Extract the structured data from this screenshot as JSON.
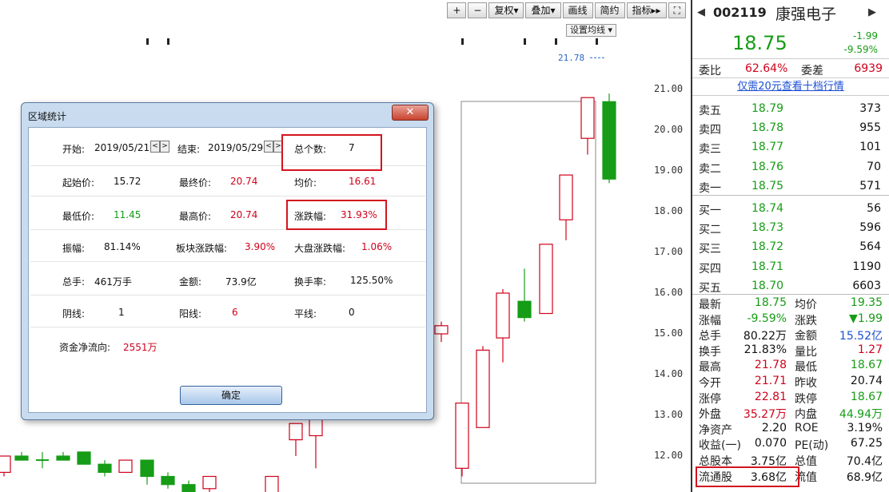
{
  "toolbar": {
    "buttons": [
      "+",
      "−",
      "复权▾",
      "叠加▾",
      "画线",
      "简约",
      "指标▸▸",
      "⛶"
    ],
    "ma_setting": "设置均线 ▾"
  },
  "chart": {
    "price_axis": [
      "21.00",
      "20.00",
      "19.00",
      "18.00",
      "17.00",
      "16.00",
      "15.00",
      "14.00",
      "13.00",
      "12.00"
    ],
    "high_marker": "21.78",
    "colors": {
      "up": "#d0021b",
      "down": "#169c16"
    }
  },
  "dialog": {
    "title": "区域统计",
    "close": "✕",
    "start_label": "开始:",
    "start_date": "2019/05/21",
    "end_label": "结束:",
    "end_date": "2019/05/29",
    "prev": "<",
    "next": ">",
    "count_label": "总个数:",
    "count": "7",
    "open_label": "起始价:",
    "open": "15.72",
    "close_label": "最终价:",
    "close_price": "20.74",
    "avg_label": "均价:",
    "avg": "16.61",
    "low_label": "最低价:",
    "low": "11.45",
    "high_label": "最高价:",
    "high": "20.74",
    "chg_label": "涨跌幅:",
    "chg": "31.93%",
    "amp_label": "振幅:",
    "amp": "81.14%",
    "sector_label": "板块涨跌幅:",
    "sector": "3.90%",
    "market_label": "大盘涨跌幅:",
    "market": "1.06%",
    "vol_label": "总手:",
    "vol": "461万手",
    "amount_label": "金额:",
    "amount": "73.9亿",
    "turnover_label": "换手率:",
    "turnover": "125.50%",
    "down_label": "阴线:",
    "down": "1",
    "up_label": "阳线:",
    "up": "6",
    "flat_label": "平线:",
    "flat": "0",
    "flow_label": "资金净流向:",
    "flow": "2551万",
    "ok": "确定"
  },
  "quote": {
    "code": "002119",
    "name": "康强电子",
    "price": "18.75",
    "change": "-1.99",
    "change_pct": "-9.59%",
    "weibi_label": "委比",
    "weibi": "62.64%",
    "weicha_label": "委差",
    "weicha": "6939",
    "link": "仅需20元查看十档行情",
    "asks": [
      {
        "label": "卖五",
        "price": "18.79",
        "vol": "373"
      },
      {
        "label": "卖四",
        "price": "18.78",
        "vol": "955"
      },
      {
        "label": "卖三",
        "price": "18.77",
        "vol": "101"
      },
      {
        "label": "卖二",
        "price": "18.76",
        "vol": "70"
      },
      {
        "label": "卖一",
        "price": "18.75",
        "vol": "571"
      }
    ],
    "bids": [
      {
        "label": "买一",
        "price": "18.74",
        "vol": "56"
      },
      {
        "label": "买二",
        "price": "18.73",
        "vol": "596"
      },
      {
        "label": "买三",
        "price": "18.72",
        "vol": "564"
      },
      {
        "label": "买四",
        "price": "18.71",
        "vol": "1190"
      },
      {
        "label": "买五",
        "price": "18.70",
        "vol": "6603"
      }
    ],
    "stats": [
      {
        "l1": "最新",
        "v1": "18.75",
        "c1": "green",
        "l2": "均价",
        "v2": "19.35",
        "c2": "green"
      },
      {
        "l1": "涨幅",
        "v1": "-9.59%",
        "c1": "green",
        "l2": "涨跌",
        "v2": "▼1.99",
        "c2": "green"
      },
      {
        "l1": "总手",
        "v1": "80.22万",
        "c1": "black",
        "l2": "金额",
        "v2": "15.52亿",
        "c2": "blue"
      },
      {
        "l1": "换手",
        "v1": "21.83%",
        "c1": "black",
        "l2": "量比",
        "v2": "1.27",
        "c2": "red"
      },
      {
        "l1": "最高",
        "v1": "21.78",
        "c1": "red",
        "l2": "最低",
        "v2": "18.67",
        "c2": "green"
      },
      {
        "l1": "今开",
        "v1": "21.71",
        "c1": "red",
        "l2": "昨收",
        "v2": "20.74",
        "c2": "black"
      },
      {
        "l1": "涨停",
        "v1": "22.81",
        "c1": "red",
        "l2": "跌停",
        "v2": "18.67",
        "c2": "green"
      },
      {
        "l1": "外盘",
        "v1": "35.27万",
        "c1": "red",
        "l2": "内盘",
        "v2": "44.94万",
        "c2": "green"
      },
      {
        "l1": "净资产",
        "v1": "2.20",
        "c1": "black",
        "l2": "ROE",
        "v2": "3.19%",
        "c2": "black"
      },
      {
        "l1": "收益(一)",
        "v1": "0.070",
        "c1": "black",
        "l2": "PE(动)",
        "v2": "67.25",
        "c2": "black"
      },
      {
        "l1": "总股本",
        "v1": "3.75亿",
        "c1": "black",
        "l2": "总值",
        "v2": "70.4亿",
        "c2": "black"
      },
      {
        "l1": "流通股",
        "v1": "3.68亿",
        "c1": "black",
        "l2": "流值",
        "v2": "68.9亿",
        "c2": "black"
      }
    ]
  }
}
